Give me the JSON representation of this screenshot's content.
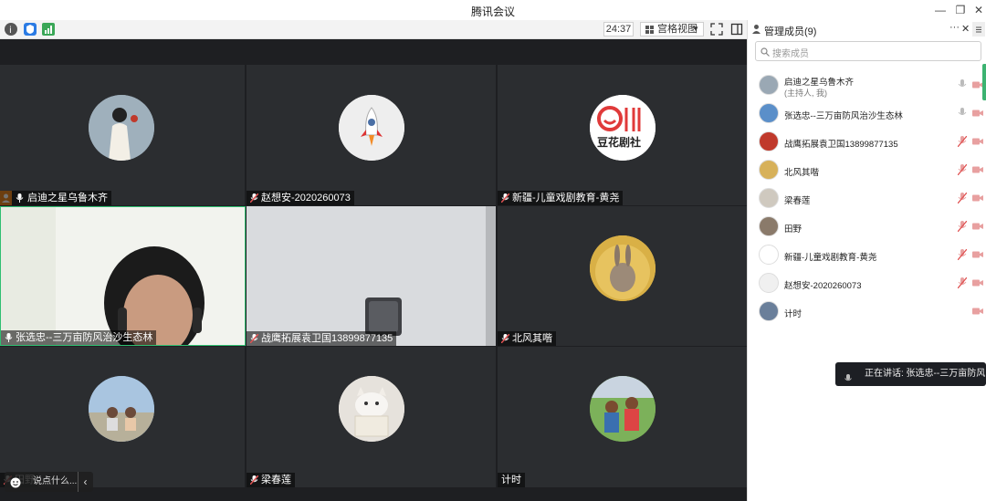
{
  "window": {
    "title": "腾讯会议",
    "minimize": "—",
    "restore": "❐",
    "close": "✕"
  },
  "toolbar": {
    "timer": "24:37",
    "view_label": "宫格视图",
    "view_caret": "▼"
  },
  "tiles": [
    {
      "name": "启迪之星乌鲁木齐",
      "host": true
    },
    {
      "name": "赵想安-2020260073"
    },
    {
      "name": "新疆-儿童戏剧教育-黄尧"
    },
    {
      "name": "张选忠--三万亩防风治沙生态林"
    },
    {
      "name": "战鹰拓展袁卫国13899877135"
    },
    {
      "name": "北风其喈"
    },
    {
      "name": "田野"
    },
    {
      "name": "梁春莲"
    },
    {
      "name": "计时"
    }
  ],
  "chat": {
    "placeholder": "说点什么...",
    "collapse": "‹"
  },
  "panel": {
    "title": "管理成员(9)",
    "more": "···",
    "close": "✕",
    "search_placeholder": "搜索成员",
    "members": [
      {
        "name": "启迪之星乌鲁木齐",
        "sub": "(主持人, 我)",
        "mic": "on",
        "cam": "off"
      },
      {
        "name": "张选忠--三万亩防风治沙生态林",
        "mic": "on",
        "cam": "off"
      },
      {
        "name": "战鹰拓展袁卫国13899877135",
        "mic": "off",
        "cam": "off"
      },
      {
        "name": "北风其喈",
        "mic": "off",
        "cam": "off"
      },
      {
        "name": "梁春莲",
        "mic": "off",
        "cam": "off"
      },
      {
        "name": "田野",
        "mic": "off",
        "cam": "off"
      },
      {
        "name": "新疆-儿童戏剧教育-黄尧",
        "mic": "off",
        "cam": "off"
      },
      {
        "name": "赵想安-2020260073",
        "mic": "off",
        "cam": "off"
      },
      {
        "name": "计时",
        "mic": "none",
        "cam": "off"
      }
    ]
  },
  "speaking": {
    "text": "正在讲话: 张选忠--三万亩防风..."
  },
  "colors": {
    "active_border": "#2fbf71",
    "muted_red": "#e05353",
    "host_badge": "#f08a24"
  }
}
